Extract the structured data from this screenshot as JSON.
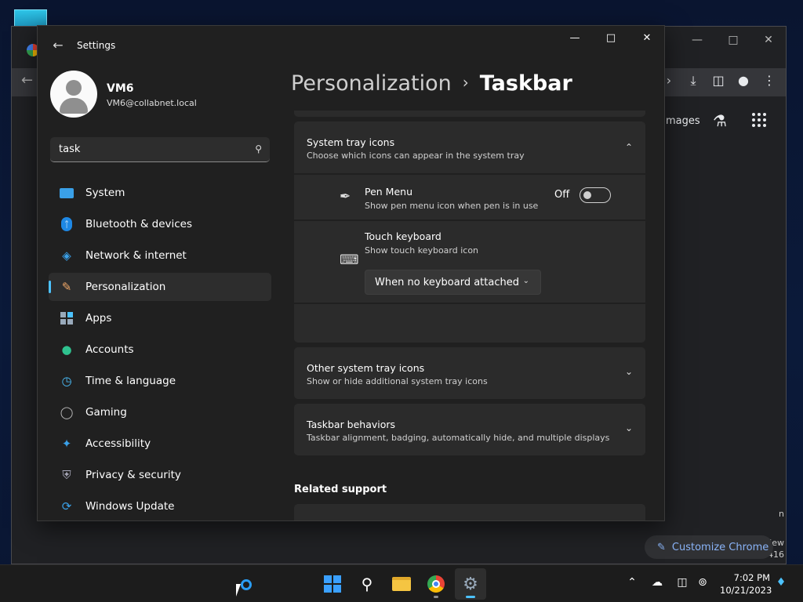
{
  "settings": {
    "title": "Settings",
    "profile": {
      "name": "VM6",
      "email": "VM6@collabnet.local"
    },
    "search": {
      "value": "task"
    },
    "nav": [
      {
        "label": "System",
        "icon": "monitor-icon"
      },
      {
        "label": "Bluetooth & devices",
        "icon": "bluetooth-icon"
      },
      {
        "label": "Network & internet",
        "icon": "wifi-icon"
      },
      {
        "label": "Personalization",
        "icon": "brush-icon",
        "active": true
      },
      {
        "label": "Apps",
        "icon": "apps-icon"
      },
      {
        "label": "Accounts",
        "icon": "person-icon"
      },
      {
        "label": "Time & language",
        "icon": "globe-clock-icon"
      },
      {
        "label": "Gaming",
        "icon": "gamepad-icon"
      },
      {
        "label": "Accessibility",
        "icon": "accessibility-icon"
      },
      {
        "label": "Privacy & security",
        "icon": "shield-icon"
      },
      {
        "label": "Windows Update",
        "icon": "update-icon"
      }
    ],
    "breadcrumb": {
      "parent": "Personalization",
      "current": "Taskbar"
    },
    "system_tray": {
      "title": "System tray icons",
      "desc": "Choose which icons can appear in the system tray",
      "pen_menu": {
        "title": "Pen Menu",
        "desc": "Show pen menu icon when pen is in use",
        "state": "Off"
      },
      "touch_keyboard": {
        "title": "Touch keyboard",
        "desc": "Show touch keyboard icon",
        "dropdown": "When no keyboard attached"
      }
    },
    "other_tray": {
      "title": "Other system tray icons",
      "desc": "Show or hide additional system tray icons"
    },
    "behaviors": {
      "title": "Taskbar behaviors",
      "desc": "Taskbar alignment, badging, automatically hide, and multiple displays"
    },
    "related_support": "Related support"
  },
  "chrome": {
    "images_link": "mages",
    "customize_label": "Customize Chrome",
    "edge_text_1": "n",
    "edge_text_2": "iew",
    "edge_text_3": "416"
  },
  "taskbar": {
    "time": "7:02 PM",
    "date": "10/21/2023"
  },
  "colors": {
    "accent": "#4cc2ff",
    "window_bg": "#202020",
    "card_bg": "#2b2b2b"
  }
}
